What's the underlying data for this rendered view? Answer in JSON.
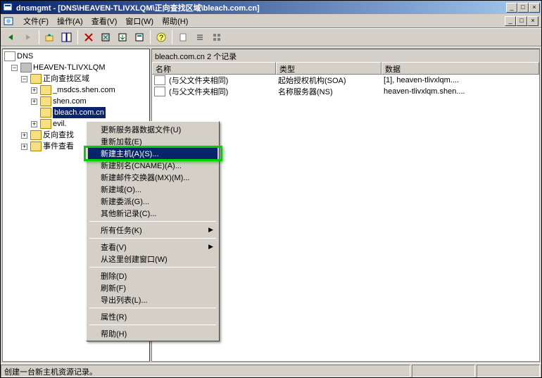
{
  "title": "dnsmgmt - [DNS\\HEAVEN-TLIVXLQM\\正向查找区域\\bleach.com.cn]",
  "menubar": {
    "file": "文件(F)",
    "action": "操作(A)",
    "view": "查看(V)",
    "window": "窗口(W)",
    "help": "帮助(H)"
  },
  "tree": {
    "root": "DNS",
    "server": "HEAVEN-TLIVXLQM",
    "fwd": "正向查找区域",
    "zone_msdcs": "_msdcs.shen.com",
    "zone_shen": "shen.com",
    "zone_bleach": "bleach.com.cn",
    "zone_evil": "evil.",
    "rev": "反向查找",
    "events": "事件查看"
  },
  "pathbar": "bleach.com.cn    2 个记录",
  "columns": {
    "name": "名称",
    "type": "类型",
    "data": "数据"
  },
  "col_widths": {
    "name": 176,
    "type": 150,
    "data": 196
  },
  "rows": [
    {
      "name": "(与父文件夹相同)",
      "type": "起始授权机构(SOA)",
      "data": "[1], heaven-tlivxlqm...."
    },
    {
      "name": "(与父文件夹相同)",
      "type": "名称服务器(NS)",
      "data": "heaven-tlivxlqm.shen...."
    }
  ],
  "context_menu": {
    "update_server": "更新服务器数据文件(U)",
    "reload": "重新加载(E)",
    "new_host": "新建主机(A)(S)...",
    "new_alias": "新建别名(CNAME)(A)...",
    "new_mx": "新建邮件交换器(MX)(M)...",
    "new_domain": "新建域(O)...",
    "new_delegation": "新建委派(G)...",
    "other_new": "其他新记录(C)...",
    "all_tasks": "所有任务(K)",
    "view": "查看(V)",
    "new_window": "从这里创建窗口(W)",
    "delete": "删除(D)",
    "refresh": "刷新(F)",
    "export": "导出列表(L)...",
    "properties": "属性(R)",
    "help": "帮助(H)"
  },
  "statusbar": "创建一台新主机资源记录。",
  "titlebar_buttons": {
    "min": "_",
    "max": "□",
    "close": "×"
  }
}
